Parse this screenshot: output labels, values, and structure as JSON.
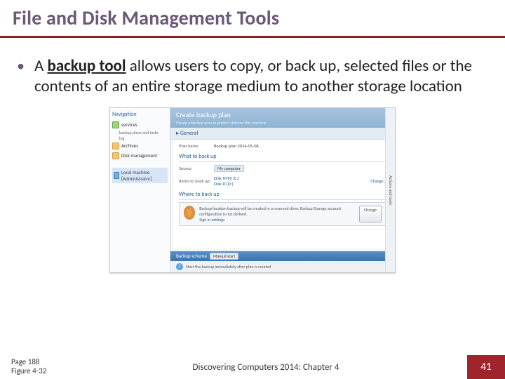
{
  "title": "File and Disk Management Tools",
  "bullet": {
    "prefix": "A ",
    "bold": "backup tool",
    "rest": " allows users to copy, or back up, selected files or the contents of an entire storage medium to another storage location"
  },
  "screenshot": {
    "nav": {
      "title": "Navigation",
      "items": [
        {
          "label": "services",
          "sub1": "backup plans and tasks",
          "sub2": "log"
        },
        {
          "label": "Archives"
        },
        {
          "label": "Disk management"
        }
      ],
      "selected": "Local machine [Administrator]"
    },
    "header": {
      "title": "Create backup plan",
      "subtitle": "Create a backup plan to protect data on this machine"
    },
    "tab": "General",
    "sections": {
      "planName": {
        "label": "Plan name",
        "value": "Backup plan 2014-05-06"
      },
      "what": {
        "heading": "What to back up",
        "source": {
          "label": "Source",
          "value": "My computer"
        },
        "items": {
          "label": "Items to back up",
          "value1": "Disk NTFS (C:)",
          "value2": "Disk D (D:)"
        },
        "change": "Change..."
      },
      "where": {
        "heading": "Where to back up",
        "box": {
          "text": "Backup location backup will be created in a reserved drive; Backup Storage account configuration is not defined.",
          "link": "Sign in settings",
          "button": "Change"
        }
      },
      "schedule": {
        "label": "Backup scheme",
        "value": "Manual start",
        "note": "Start the backup immediately after plan is created"
      }
    },
    "footIcon": "?",
    "rightTab": "Actions and tools"
  },
  "footer": {
    "page": "Page 188",
    "figure": "Figure 4-32",
    "chapter": "Discovering Computers 2014: Chapter 4",
    "slide": "41"
  }
}
